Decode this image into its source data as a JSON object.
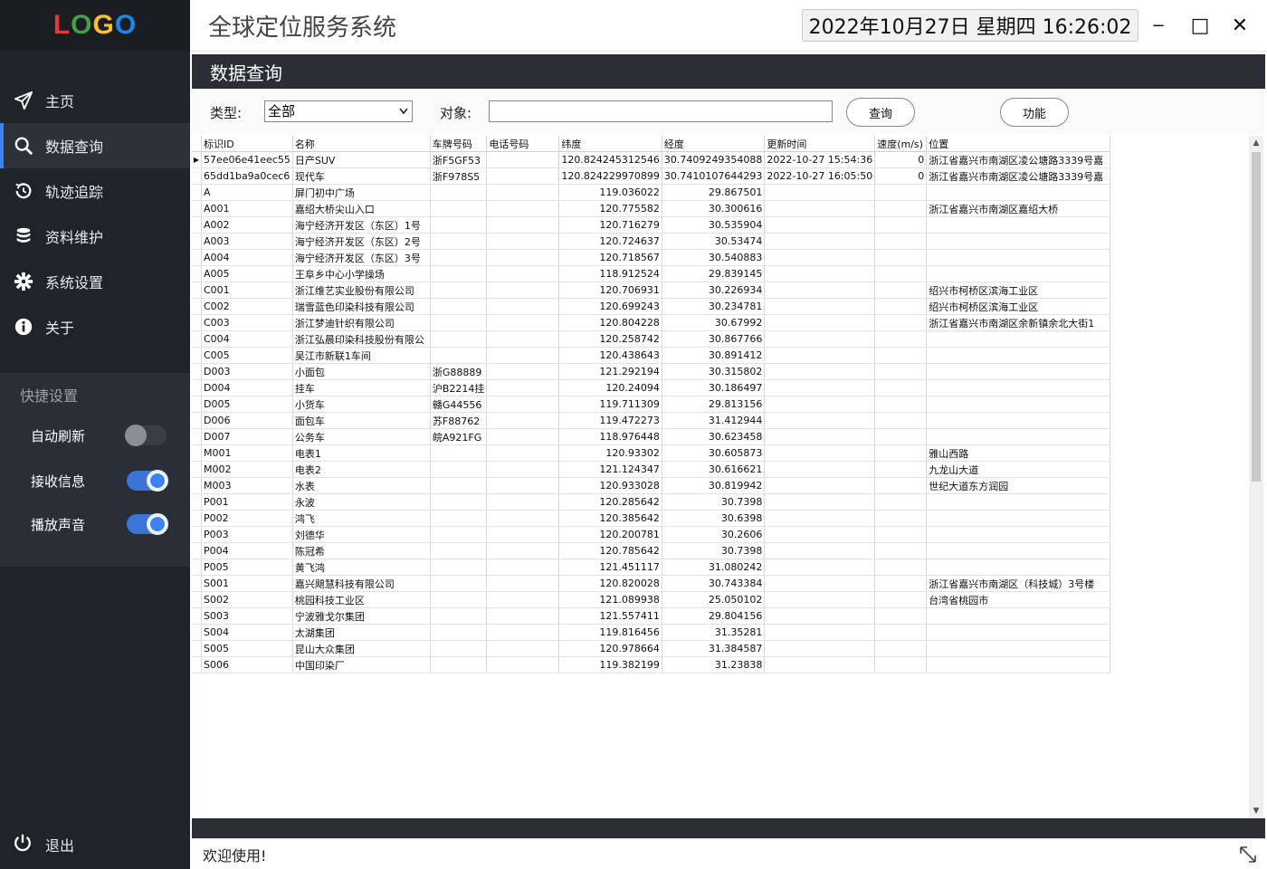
{
  "sidebar": {
    "logo_letters": [
      "L",
      "O",
      "G",
      "O"
    ],
    "nav": [
      {
        "label": "主页",
        "icon": "send-icon"
      },
      {
        "label": "数据查询",
        "icon": "search-icon",
        "active": true
      },
      {
        "label": "轨迹追踪",
        "icon": "history-icon"
      },
      {
        "label": "资料维护",
        "icon": "database-icon"
      },
      {
        "label": "系统设置",
        "icon": "gear-icon"
      },
      {
        "label": "关于",
        "icon": "info-icon"
      }
    ],
    "quick_title": "快捷设置",
    "quick": [
      {
        "label": "自动刷新",
        "on": false
      },
      {
        "label": "接收信息",
        "on": true
      },
      {
        "label": "播放声音",
        "on": true
      }
    ],
    "logout_label": "退出"
  },
  "header": {
    "title": "全球定位服务系统",
    "clock": "2022年10月27日 星期四 16:26:02",
    "min": "−",
    "max": "□",
    "close": "✕"
  },
  "section_title": "数据查询",
  "filter": {
    "type_label": "类型:",
    "type_value": "全部",
    "object_label": "对象:",
    "object_value": "",
    "query_button": "查询",
    "function_button": "功能"
  },
  "table": {
    "columns": [
      "标识ID",
      "名称",
      "车牌号码",
      "电话号码",
      "纬度",
      "经度",
      "更新时间",
      "速度(m/s)",
      "位置"
    ],
    "rows": [
      [
        "57ee06e41eec55",
        "日产SUV",
        "浙F5GF53",
        "",
        "120.824245312546",
        "30.7409249354088",
        "2022-10-27 15:54:36",
        "0",
        "浙江省嘉兴市南湖区凌公塘路3339号嘉"
      ],
      [
        "65dd1ba9a0cec6",
        "现代车",
        "浙F978S5",
        "",
        "120.824229970899",
        "30.7410107644293",
        "2022-10-27 16:05:50",
        "0",
        "浙江省嘉兴市南湖区凌公塘路3339号嘉"
      ],
      [
        "A",
        "屏门初中广场",
        "",
        "",
        "119.036022",
        "29.867501",
        "",
        "",
        ""
      ],
      [
        "A001",
        "嘉绍大桥尖山入口",
        "",
        "",
        "120.775582",
        "30.300616",
        "",
        "",
        "浙江省嘉兴市南湖区嘉绍大桥"
      ],
      [
        "A002",
        "海宁经济开发区（东区）1号",
        "",
        "",
        "120.716279",
        "30.535904",
        "",
        "",
        ""
      ],
      [
        "A003",
        "海宁经济开发区（东区）2号",
        "",
        "",
        "120.724637",
        "30.53474",
        "",
        "",
        ""
      ],
      [
        "A004",
        "海宁经济开发区（东区）3号",
        "",
        "",
        "120.718567",
        "30.540883",
        "",
        "",
        ""
      ],
      [
        "A005",
        "王阜乡中心小学操场",
        "",
        "",
        "118.912524",
        "29.839145",
        "",
        "",
        ""
      ],
      [
        "C001",
        "浙江维艺实业股份有限公司",
        "",
        "",
        "120.706931",
        "30.226934",
        "",
        "",
        "绍兴市柯桥区滨海工业区"
      ],
      [
        "C002",
        "瑞雪蓝色印染科技有限公司",
        "",
        "",
        "120.699243",
        "30.234781",
        "",
        "",
        "绍兴市柯桥区滨海工业区"
      ],
      [
        "C003",
        "浙江梦迪针织有限公司",
        "",
        "",
        "120.804228",
        "30.67992",
        "",
        "",
        "浙江省嘉兴市南湖区余新镇余北大街1"
      ],
      [
        "C004",
        "浙江弘晨印染科技股份有限公",
        "",
        "",
        "120.258742",
        "30.867766",
        "",
        "",
        ""
      ],
      [
        "C005",
        "吴江市新联1车间",
        "",
        "",
        "120.438643",
        "30.891412",
        "",
        "",
        ""
      ],
      [
        "D003",
        "小面包",
        "浙G88889",
        "",
        "121.292194",
        "30.315802",
        "",
        "",
        ""
      ],
      [
        "D004",
        "挂车",
        "沪B2214挂",
        "",
        "120.24094",
        "30.186497",
        "",
        "",
        ""
      ],
      [
        "D005",
        "小货车",
        "赣G44556",
        "",
        "119.711309",
        "29.813156",
        "",
        "",
        ""
      ],
      [
        "D006",
        "面包车",
        "苏F88762",
        "",
        "119.472273",
        "31.412944",
        "",
        "",
        ""
      ],
      [
        "D007",
        "公务车",
        "皖A921FG",
        "",
        "118.976448",
        "30.623458",
        "",
        "",
        ""
      ],
      [
        "M001",
        "电表1",
        "",
        "",
        "120.93302",
        "30.605873",
        "",
        "",
        "雅山西路"
      ],
      [
        "M002",
        "电表2",
        "",
        "",
        "121.124347",
        "30.616621",
        "",
        "",
        "九龙山大道"
      ],
      [
        "M003",
        "水表",
        "",
        "",
        "120.933028",
        "30.819942",
        "",
        "",
        "世纪大道东方润园"
      ],
      [
        "P001",
        "永波",
        "",
        "",
        "120.285642",
        "30.7398",
        "",
        "",
        ""
      ],
      [
        "P002",
        "鸿飞",
        "",
        "",
        "120.385642",
        "30.6398",
        "",
        "",
        ""
      ],
      [
        "P003",
        "刘德华",
        "",
        "",
        "120.200781",
        "30.2606",
        "",
        "",
        ""
      ],
      [
        "P004",
        "陈冠希",
        "",
        "",
        "120.785642",
        "30.7398",
        "",
        "",
        ""
      ],
      [
        "P005",
        "黄飞鸿",
        "",
        "",
        "121.451117",
        "31.080242",
        "",
        "",
        ""
      ],
      [
        "S001",
        "嘉兴飓慧科技有限公司",
        "",
        "",
        "120.820028",
        "30.743384",
        "",
        "",
        "浙江省嘉兴市南湖区（科技城）3号楼"
      ],
      [
        "S002",
        "桃园科技工业区",
        "",
        "",
        "121.089938",
        "25.050102",
        "",
        "",
        "台湾省桃园市"
      ],
      [
        "S003",
        "宁波雅戈尔集团",
        "",
        "",
        "121.557411",
        "29.804156",
        "",
        "",
        ""
      ],
      [
        "S004",
        "太湖集团",
        "",
        "",
        "119.816456",
        "31.35281",
        "",
        "",
        ""
      ],
      [
        "S005",
        "昆山大众集团",
        "",
        "",
        "120.978664",
        "31.384587",
        "",
        "",
        ""
      ],
      [
        "S006",
        "中国印染厂",
        "",
        "",
        "119.382199",
        "31.23838",
        "",
        "",
        ""
      ]
    ]
  },
  "status": "欢迎使用!"
}
